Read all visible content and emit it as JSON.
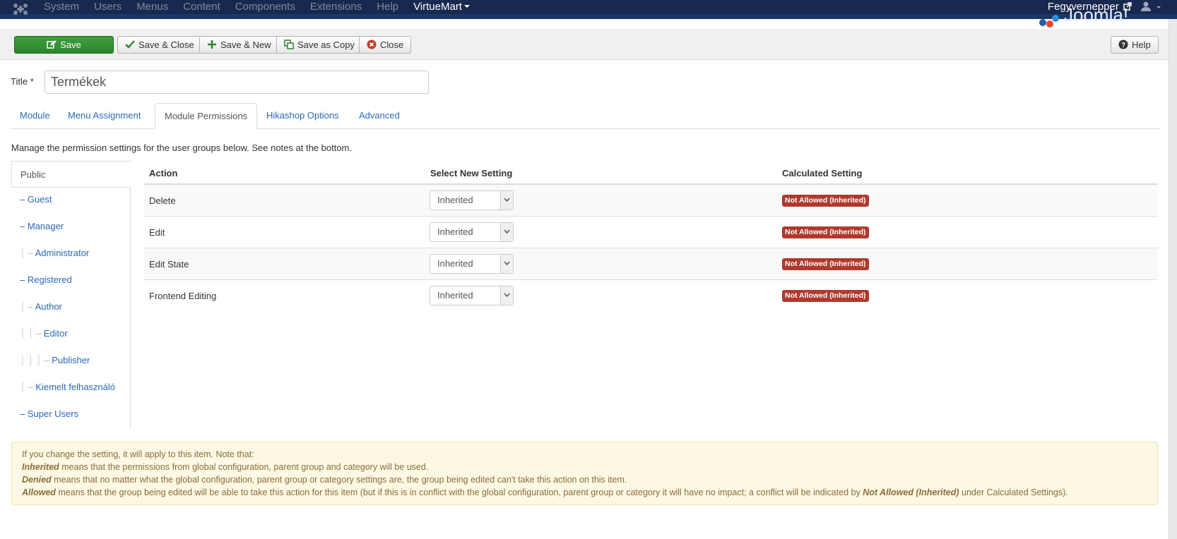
{
  "topnav": {
    "menu": [
      "System",
      "Users",
      "Menus",
      "Content",
      "Components",
      "Extensions",
      "Help"
    ],
    "virtuemart": "VirtueMart",
    "site_link": "Fegyvernepper"
  },
  "toolbar": {
    "save": "Save",
    "save_close": "Save & Close",
    "save_new": "Save & New",
    "save_copy": "Save as Copy",
    "close": "Close",
    "help": "Help"
  },
  "form": {
    "title_label": "Title *",
    "title_value": "Termékek"
  },
  "tabs": [
    "Module",
    "Menu Assignment",
    "Module Permissions",
    "Hikashop Options",
    "Advanced"
  ],
  "intro": "Manage the permission settings for the user groups below. See notes at the bottom.",
  "groups": [
    {
      "prefix": "",
      "label": "Public"
    },
    {
      "prefix": "– ",
      "label": "Guest"
    },
    {
      "prefix": "– ",
      "label": "Manager"
    },
    {
      "prefix": "┊   – ",
      "label": "Administrator"
    },
    {
      "prefix": "– ",
      "label": "Registered"
    },
    {
      "prefix": "┊   – ",
      "label": "Author"
    },
    {
      "prefix": "┊   ┊   – ",
      "label": "Editor"
    },
    {
      "prefix": "┊   ┊   ┊   – ",
      "label": "Publisher"
    },
    {
      "prefix": "┊   – ",
      "label": "Kiemelt felhasználó"
    },
    {
      "prefix": "– ",
      "label": "Super Users"
    }
  ],
  "table": {
    "headers": {
      "action": "Action",
      "select": "Select New Setting",
      "calculated": "Calculated Setting"
    },
    "rows": [
      {
        "action": "Delete",
        "setting": "Inherited",
        "calculated": "Not Allowed (Inherited)"
      },
      {
        "action": "Edit",
        "setting": "Inherited",
        "calculated": "Not Allowed (Inherited)"
      },
      {
        "action": "Edit State",
        "setting": "Inherited",
        "calculated": "Not Allowed (Inherited)"
      },
      {
        "action": "Frontend Editing",
        "setting": "Inherited",
        "calculated": "Not Allowed (Inherited)"
      }
    ]
  },
  "notes": {
    "line1": "If you change the setting, it will apply to this item. Note that:",
    "inherited_term": "Inherited",
    "inherited_text": " means that the permissions from global configuration, parent group and category will be used.",
    "denied_term": "Denied",
    "denied_text": " means that no matter what the global configuration, parent group or category settings are, the group being edited can't take this action on this item.",
    "allowed_term": "Allowed",
    "allowed_text": " means that the group being edited will be able to take this action for this item (but if this is in conflict with the global configuration, parent group or category it will have no impact; a conflict will be indicated by ",
    "allowed_term2": "Not Allowed (Inherited)",
    "allowed_text2": " under Calculated Settings)."
  },
  "colors": {
    "navbar": "#17294e",
    "link": "#2a69b8",
    "badge": "#b0392d",
    "save": "#2f8a2f",
    "notes_bg": "#fcf8e3"
  }
}
